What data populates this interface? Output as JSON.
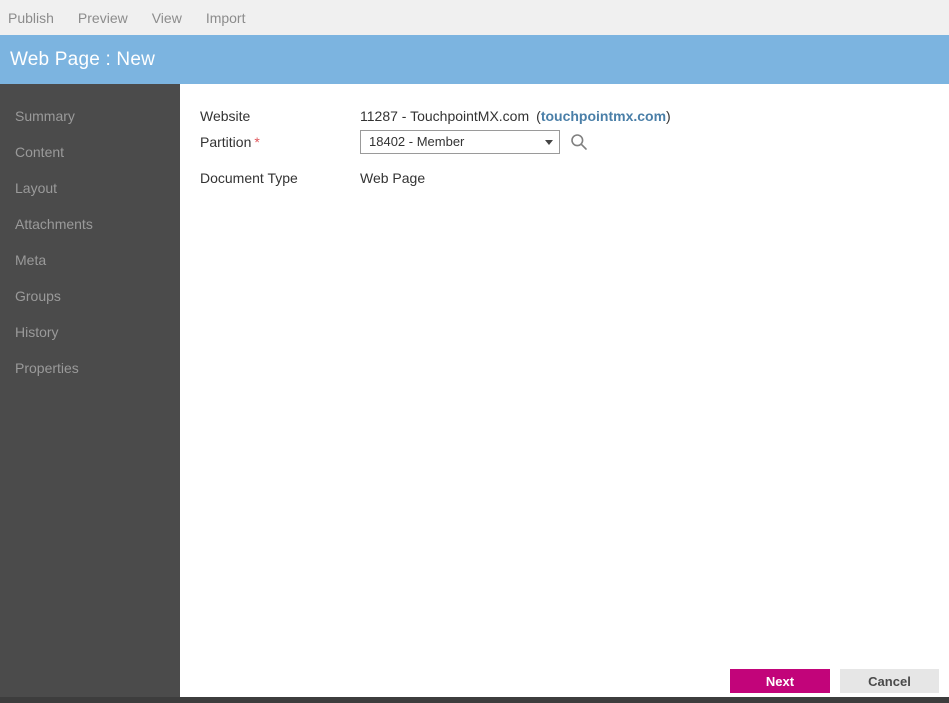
{
  "menubar": {
    "items": [
      {
        "label": "Publish"
      },
      {
        "label": "Preview"
      },
      {
        "label": "View"
      },
      {
        "label": "Import"
      }
    ]
  },
  "titlebar": {
    "title": "Web Page : New"
  },
  "sidebar": {
    "items": [
      {
        "label": "Summary"
      },
      {
        "label": "Content"
      },
      {
        "label": "Layout"
      },
      {
        "label": "Attachments"
      },
      {
        "label": "Meta"
      },
      {
        "label": "Groups"
      },
      {
        "label": "History"
      },
      {
        "label": "Properties"
      }
    ]
  },
  "form": {
    "website": {
      "label": "Website",
      "value": "11287 - TouchpointMX.com",
      "link_text": "touchpointmx.com",
      "paren_open": "(",
      "paren_close": ")"
    },
    "partition": {
      "label": "Partition",
      "required_marker": "*",
      "selected": "18402 - Member",
      "search_icon": "search-icon"
    },
    "document_type": {
      "label": "Document Type",
      "value": "Web Page"
    }
  },
  "footer": {
    "next_label": "Next",
    "cancel_label": "Cancel"
  },
  "colors": {
    "title_bar": "#7cb4e0",
    "sidebar": "#4b4b4b",
    "menu_bar": "#f0f0f0",
    "primary_button": "#c2047a",
    "secondary_button": "#e6e6e6",
    "link": "#4a7fa8",
    "required": "#e0565b"
  }
}
